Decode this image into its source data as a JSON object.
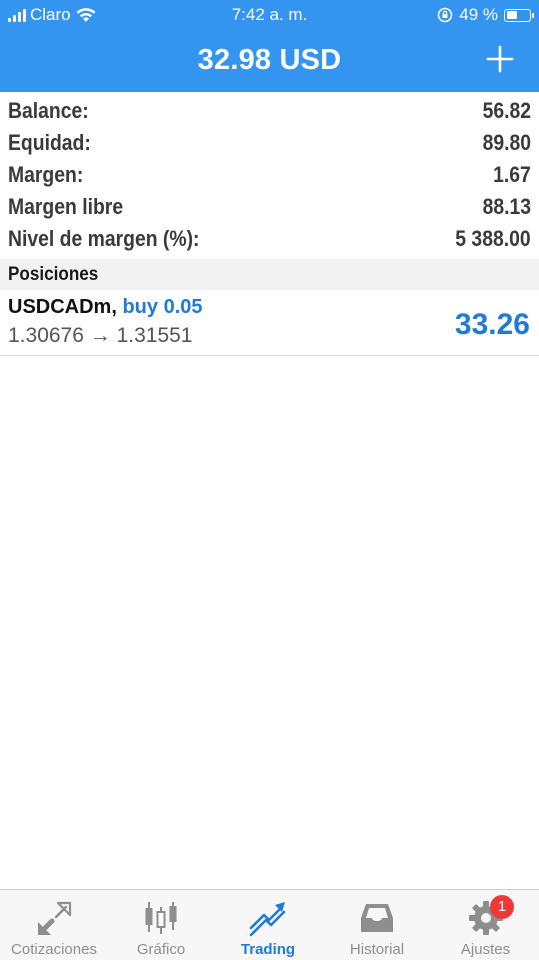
{
  "status_bar": {
    "carrier": "Claro",
    "time": "7:42 a. m.",
    "battery": "49 %",
    "battery_level": 0.49
  },
  "header": {
    "title": "32.98 USD",
    "add_icon": "plus-icon",
    "background_color": "#3395f0"
  },
  "account": [
    {
      "label": "Balance:",
      "value": "56.82"
    },
    {
      "label": "Equidad:",
      "value": "89.80"
    },
    {
      "label": "Margen:",
      "value": "1.67"
    },
    {
      "label": "Margen libre",
      "value": "88.13"
    },
    {
      "label": "Nivel de margen (%):",
      "value": "5 388.00"
    }
  ],
  "positions": {
    "section_title": "Posiciones",
    "items": [
      {
        "symbol": "USDCADm,",
        "direction": "buy 0.05",
        "prices": "1.30676 → 1.31551",
        "profit": "33.26",
        "profit_color": "#1e7bd6"
      }
    ]
  },
  "tabs": [
    {
      "label": "Cotizaciones",
      "icon": "quotes-arrows-icon",
      "active": false
    },
    {
      "label": "Gráfico",
      "icon": "candlestick-chart-icon",
      "active": false
    },
    {
      "label": "Trading",
      "icon": "trading-trend-icon",
      "active": true
    },
    {
      "label": "Historial",
      "icon": "history-inbox-icon",
      "active": false
    },
    {
      "label": "Ajustes",
      "icon": "gear-icon",
      "active": false,
      "badge": "1"
    }
  ],
  "colors": {
    "accent": "#1e7bd6",
    "inactive_tab": "#8e8e8e",
    "badge": "#f0383a"
  }
}
